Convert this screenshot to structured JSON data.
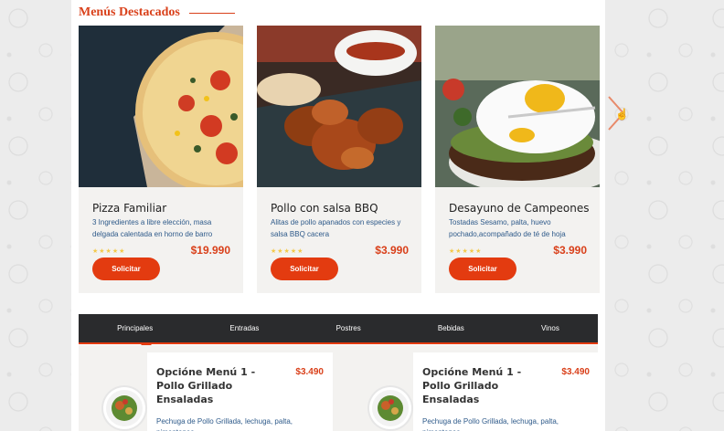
{
  "section": {
    "title": "Menús Destacados"
  },
  "cards": [
    {
      "title": "Pizza Familiar",
      "desc": "3 Ingredientes a libre elección, masa delgada calentada en horno de barro",
      "stars": "★★★★★",
      "price": "$19.990",
      "button": "Solicitar"
    },
    {
      "title": "Pollo con salsa BBQ",
      "desc": "Alitas de pollo apanados con especies y salsa BBQ cacera",
      "stars": "★★★★★",
      "price": "$3.990",
      "button": "Solicitar"
    },
    {
      "title": "Desayuno de Campeones",
      "desc": "Tostadas Sesamo, palta, huevo pochado,acompañado de té de hoja",
      "stars": "★★★★★",
      "price": "$3.990",
      "button": "Solicitar"
    }
  ],
  "tabs": [
    "Principales",
    "Entradas",
    "Postres",
    "Bebidas",
    "Vinos"
  ],
  "menu_items": [
    {
      "title": "Opcióne Menú 1 - Pollo Grillado Ensaladas",
      "price": "$3.490",
      "desc": "Pechuga de Pollo Grillada, lechuga, palta, pimentones"
    },
    {
      "title": "Opcióne Menú 1 - Pollo Grillado Ensaladas",
      "price": "$3.490",
      "desc": "Pechuga de Pollo Grillada, lechuga, palta, pimentones"
    }
  ],
  "colors": {
    "accent": "#e33b10",
    "title": "#d9401a",
    "tabbar": "#2a2b2d"
  }
}
